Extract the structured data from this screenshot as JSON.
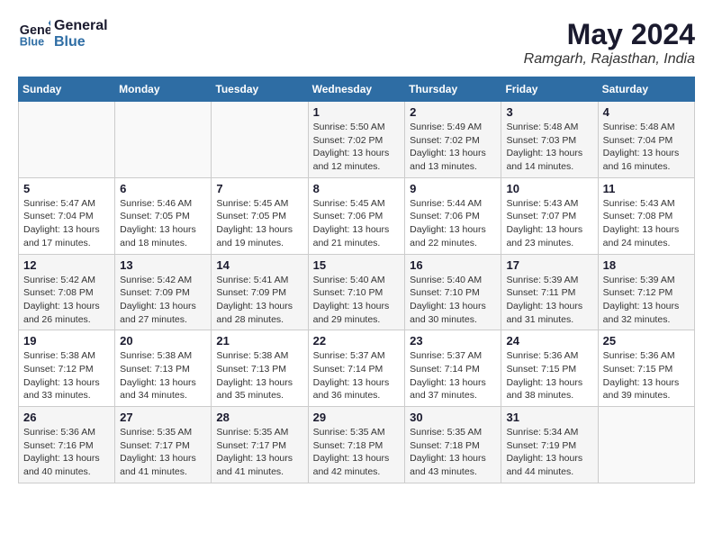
{
  "header": {
    "logo_line1": "General",
    "logo_line2": "Blue",
    "month_title": "May 2024",
    "location": "Ramgarh, Rajasthan, India"
  },
  "weekdays": [
    "Sunday",
    "Monday",
    "Tuesday",
    "Wednesday",
    "Thursday",
    "Friday",
    "Saturday"
  ],
  "weeks": [
    [
      {
        "day": "",
        "info": ""
      },
      {
        "day": "",
        "info": ""
      },
      {
        "day": "",
        "info": ""
      },
      {
        "day": "1",
        "info": "Sunrise: 5:50 AM\nSunset: 7:02 PM\nDaylight: 13 hours and 12 minutes."
      },
      {
        "day": "2",
        "info": "Sunrise: 5:49 AM\nSunset: 7:02 PM\nDaylight: 13 hours and 13 minutes."
      },
      {
        "day": "3",
        "info": "Sunrise: 5:48 AM\nSunset: 7:03 PM\nDaylight: 13 hours and 14 minutes."
      },
      {
        "day": "4",
        "info": "Sunrise: 5:48 AM\nSunset: 7:04 PM\nDaylight: 13 hours and 16 minutes."
      }
    ],
    [
      {
        "day": "5",
        "info": "Sunrise: 5:47 AM\nSunset: 7:04 PM\nDaylight: 13 hours and 17 minutes."
      },
      {
        "day": "6",
        "info": "Sunrise: 5:46 AM\nSunset: 7:05 PM\nDaylight: 13 hours and 18 minutes."
      },
      {
        "day": "7",
        "info": "Sunrise: 5:45 AM\nSunset: 7:05 PM\nDaylight: 13 hours and 19 minutes."
      },
      {
        "day": "8",
        "info": "Sunrise: 5:45 AM\nSunset: 7:06 PM\nDaylight: 13 hours and 21 minutes."
      },
      {
        "day": "9",
        "info": "Sunrise: 5:44 AM\nSunset: 7:06 PM\nDaylight: 13 hours and 22 minutes."
      },
      {
        "day": "10",
        "info": "Sunrise: 5:43 AM\nSunset: 7:07 PM\nDaylight: 13 hours and 23 minutes."
      },
      {
        "day": "11",
        "info": "Sunrise: 5:43 AM\nSunset: 7:08 PM\nDaylight: 13 hours and 24 minutes."
      }
    ],
    [
      {
        "day": "12",
        "info": "Sunrise: 5:42 AM\nSunset: 7:08 PM\nDaylight: 13 hours and 26 minutes."
      },
      {
        "day": "13",
        "info": "Sunrise: 5:42 AM\nSunset: 7:09 PM\nDaylight: 13 hours and 27 minutes."
      },
      {
        "day": "14",
        "info": "Sunrise: 5:41 AM\nSunset: 7:09 PM\nDaylight: 13 hours and 28 minutes."
      },
      {
        "day": "15",
        "info": "Sunrise: 5:40 AM\nSunset: 7:10 PM\nDaylight: 13 hours and 29 minutes."
      },
      {
        "day": "16",
        "info": "Sunrise: 5:40 AM\nSunset: 7:10 PM\nDaylight: 13 hours and 30 minutes."
      },
      {
        "day": "17",
        "info": "Sunrise: 5:39 AM\nSunset: 7:11 PM\nDaylight: 13 hours and 31 minutes."
      },
      {
        "day": "18",
        "info": "Sunrise: 5:39 AM\nSunset: 7:12 PM\nDaylight: 13 hours and 32 minutes."
      }
    ],
    [
      {
        "day": "19",
        "info": "Sunrise: 5:38 AM\nSunset: 7:12 PM\nDaylight: 13 hours and 33 minutes."
      },
      {
        "day": "20",
        "info": "Sunrise: 5:38 AM\nSunset: 7:13 PM\nDaylight: 13 hours and 34 minutes."
      },
      {
        "day": "21",
        "info": "Sunrise: 5:38 AM\nSunset: 7:13 PM\nDaylight: 13 hours and 35 minutes."
      },
      {
        "day": "22",
        "info": "Sunrise: 5:37 AM\nSunset: 7:14 PM\nDaylight: 13 hours and 36 minutes."
      },
      {
        "day": "23",
        "info": "Sunrise: 5:37 AM\nSunset: 7:14 PM\nDaylight: 13 hours and 37 minutes."
      },
      {
        "day": "24",
        "info": "Sunrise: 5:36 AM\nSunset: 7:15 PM\nDaylight: 13 hours and 38 minutes."
      },
      {
        "day": "25",
        "info": "Sunrise: 5:36 AM\nSunset: 7:15 PM\nDaylight: 13 hours and 39 minutes."
      }
    ],
    [
      {
        "day": "26",
        "info": "Sunrise: 5:36 AM\nSunset: 7:16 PM\nDaylight: 13 hours and 40 minutes."
      },
      {
        "day": "27",
        "info": "Sunrise: 5:35 AM\nSunset: 7:17 PM\nDaylight: 13 hours and 41 minutes."
      },
      {
        "day": "28",
        "info": "Sunrise: 5:35 AM\nSunset: 7:17 PM\nDaylight: 13 hours and 41 minutes."
      },
      {
        "day": "29",
        "info": "Sunrise: 5:35 AM\nSunset: 7:18 PM\nDaylight: 13 hours and 42 minutes."
      },
      {
        "day": "30",
        "info": "Sunrise: 5:35 AM\nSunset: 7:18 PM\nDaylight: 13 hours and 43 minutes."
      },
      {
        "day": "31",
        "info": "Sunrise: 5:34 AM\nSunset: 7:19 PM\nDaylight: 13 hours and 44 minutes."
      },
      {
        "day": "",
        "info": ""
      }
    ]
  ]
}
